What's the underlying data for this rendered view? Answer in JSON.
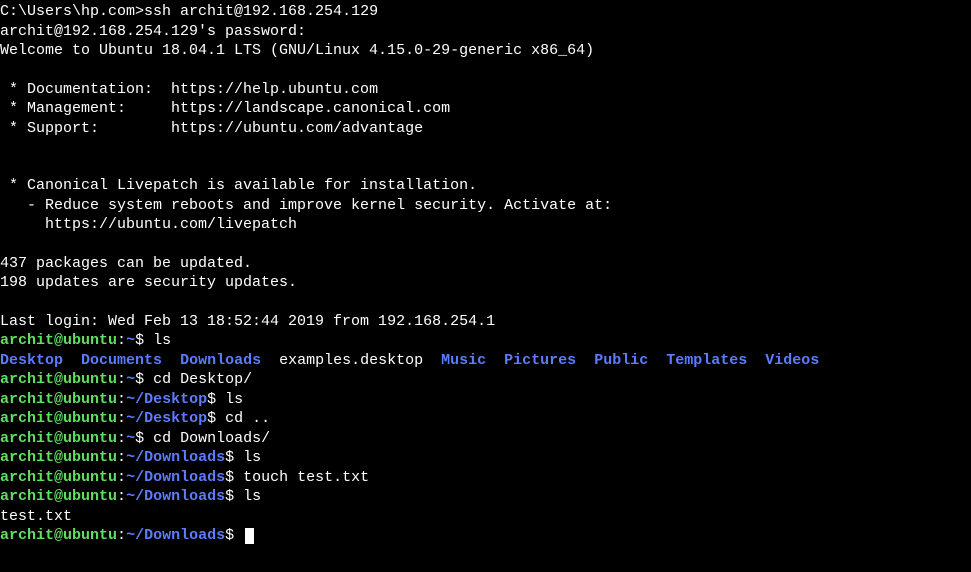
{
  "initial_prompt": "C:\\Users\\hp.com>",
  "ssh_cmd": "ssh archit@192.168.254.129",
  "password_line": "archit@192.168.254.129's password:",
  "welcome": "Welcome to Ubuntu 18.04.1 LTS (GNU/Linux 4.15.0-29-generic x86_64)",
  "doc_label": " * Documentation:  ",
  "doc_url": "https://help.ubuntu.com",
  "mgmt_label": " * Management:     ",
  "mgmt_url": "https://landscape.canonical.com",
  "support_label": " * Support:        ",
  "support_url": "https://ubuntu.com/advantage",
  "livepatch1": " * Canonical Livepatch is available for installation.",
  "livepatch2": "   - Reduce system reboots and improve kernel security. Activate at:",
  "livepatch3": "     https://ubuntu.com/livepatch",
  "updates1": "437 packages can be updated.",
  "updates2": "198 updates are security updates.",
  "lastlogin": "Last login: Wed Feb 13 18:52:44 2019 from 192.168.254.1",
  "prompt": {
    "user": "archit",
    "at": "@",
    "host": "ubuntu",
    "colon": ":",
    "home": "~",
    "desktop": "~/Desktop",
    "downloads": "~/Downloads",
    "dollar": "$ "
  },
  "cmd": {
    "ls": "ls",
    "cd_desktop": "cd Desktop/",
    "cd_up": "cd ..",
    "cd_downloads": "cd Downloads/",
    "touch": "touch test.txt"
  },
  "ls_home": {
    "desktop": "Desktop",
    "documents": "Documents",
    "downloads": "Downloads",
    "examples": "examples.desktop",
    "music": "Music",
    "pictures": "Pictures",
    "public": "Public",
    "templates": "Templates",
    "videos": "Videos"
  },
  "file_listing": "test.txt",
  "sp2": "  ",
  "sp3": "   "
}
